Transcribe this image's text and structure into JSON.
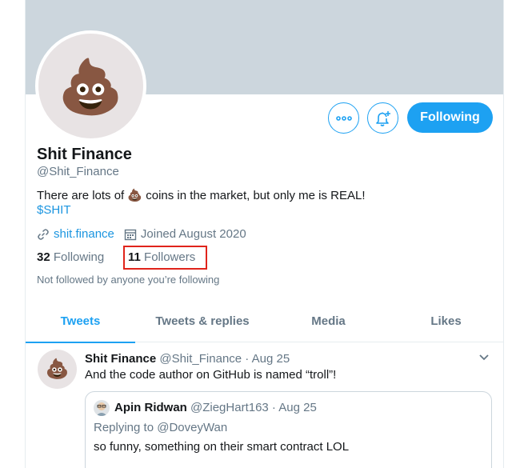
{
  "profile": {
    "avatar_emoji": "💩",
    "name": "Shit Finance",
    "handle": "@Shit_Finance",
    "bio_before": "There are lots of ",
    "bio_emoji": "💩",
    "bio_after": " coins in the market, but only me is REAL!",
    "cashtag": "$SHIT",
    "website": "shit.finance",
    "joined": "Joined August 2020",
    "following_count": "32",
    "following_label": "Following",
    "followers_count": "11",
    "followers_label": "Followers",
    "not_followed": "Not followed by anyone you’re following"
  },
  "actions": {
    "more_icon": "ellipsis-icon",
    "notify_icon": "bell-plus-icon",
    "follow_label": "Following"
  },
  "tabs": [
    {
      "label": "Tweets",
      "active": true
    },
    {
      "label": "Tweets & replies",
      "active": false
    },
    {
      "label": "Media",
      "active": false
    },
    {
      "label": "Likes",
      "active": false
    }
  ],
  "tweet": {
    "avatar_emoji": "💩",
    "author": "Shit Finance",
    "meta": " @Shit_Finance · Aug 25",
    "text": "And the code author on GitHub is named “troll”!",
    "quote": {
      "author": "Apin Ridwan",
      "meta": " @ZiegHart163 · Aug 25",
      "replying": "Replying to @DoveyWan",
      "text": "so funny, something on their smart contract LOL"
    }
  },
  "colors": {
    "accent": "#1da1f2",
    "highlight_box": "#e0241b",
    "banner": "#ccd6dd"
  }
}
